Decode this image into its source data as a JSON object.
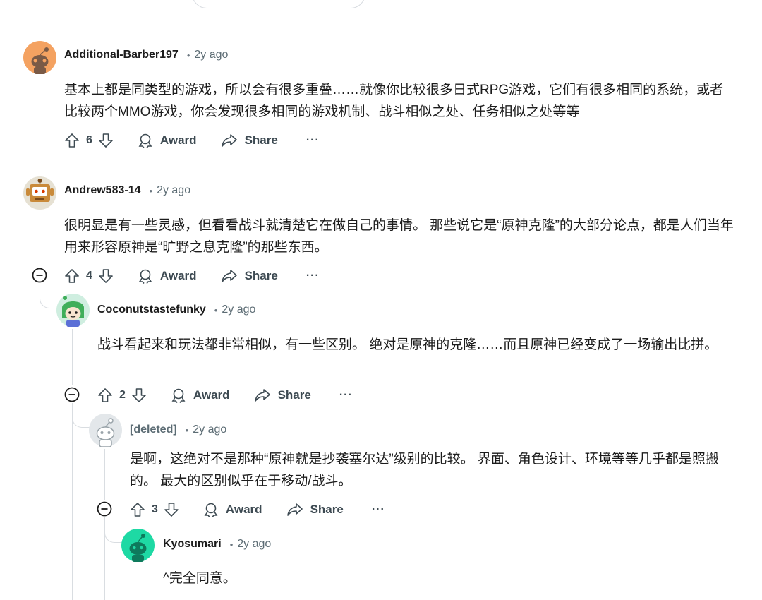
{
  "comments": [
    {
      "author": "Additional-Barber197",
      "time": "2y ago",
      "text": "基本上都是同类型的游戏，所以会有很多重叠……就像你比较很多日式RPG游戏，它们有很多相同的系统，或者比较两个MMO游戏，你会发现很多相同的游戏机制、战斗相似之处、任务相似之处等等",
      "votes": "6",
      "award": "Award",
      "share": "Share",
      "more": "···"
    },
    {
      "author": "Andrew583-14",
      "time": "2y ago",
      "text": "很明显是有一些灵感，但看看战斗就清楚它在做自己的事情。 那些说它是“原神克隆”的大部分论点，都是人们当年用来形容原神是“旷野之息克隆”的那些东西。",
      "votes": "4",
      "award": "Award",
      "share": "Share",
      "more": "···"
    },
    {
      "author": "Coconutstastefunky",
      "time": "2y ago",
      "text": "战斗看起来和玩法都非常相似，有一些区别。 绝对是原神的克隆……而且原神已经变成了一场输出比拼。",
      "votes": "2",
      "award": "Award",
      "share": "Share",
      "more": "···"
    },
    {
      "author": "[deleted]",
      "time": "2y ago",
      "text": "是啊，这绝对不是那种“原神就是抄袭塞尔达”级别的比较。 界面、角色设计、环境等等几乎都是照搬的。 最大的区别似乎在于移动/战斗。",
      "votes": "3",
      "award": "Award",
      "share": "Share",
      "more": "···"
    },
    {
      "author": "Kyosumari",
      "time": "2y ago",
      "text": "^完全同意。"
    }
  ],
  "colors": {
    "avatar_orange": "#f4a261",
    "avatar_teal": "#1ed9a4",
    "thread_line": "#d9dde1",
    "muted_text": "#5c6c74"
  },
  "icons": [
    "upvote-icon",
    "downvote-icon",
    "award-icon",
    "share-icon",
    "more-icon",
    "collapse-icon"
  ]
}
